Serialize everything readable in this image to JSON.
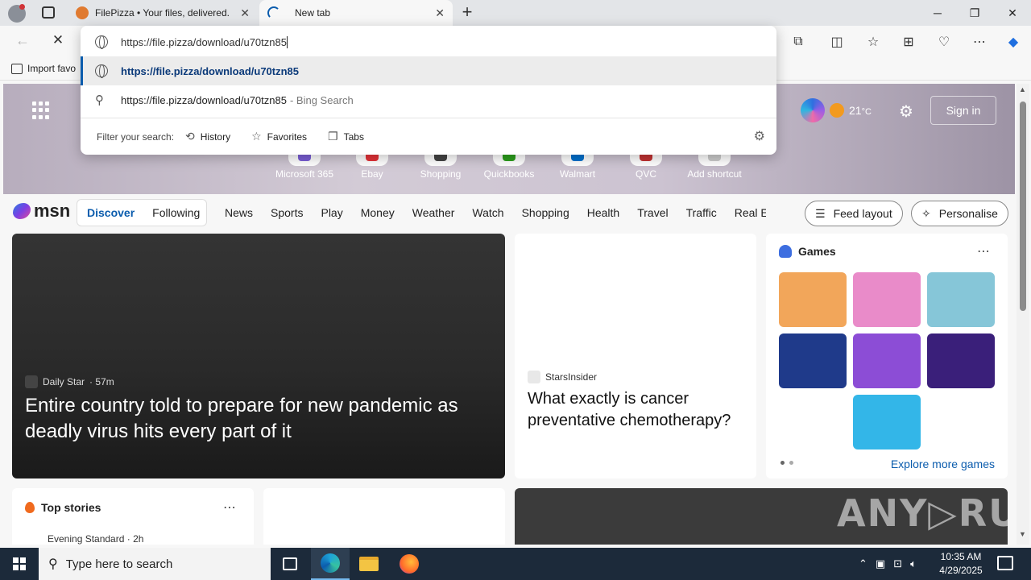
{
  "tabs": [
    {
      "title": "FilePizza • Your files, delivered.",
      "favicon": "pizza-icon"
    },
    {
      "title": "New tab",
      "favicon": "loading-icon"
    }
  ],
  "window_controls": {
    "minimize": "─",
    "restore": "❐",
    "close": "✕"
  },
  "toolbar": {
    "back": "←",
    "stop": "✕",
    "icons": [
      "extensions-icon",
      "split-screen-icon",
      "favorites-icon",
      "collections-icon",
      "performance-icon",
      "more-icon",
      "copilot-icon"
    ]
  },
  "favorites_bar": {
    "import_label": "Import favo"
  },
  "omnibox": {
    "input_value": "https://file.pizza/download/u70tzn85",
    "suggestion_url": "https://file.pizza/download/u70tzn85",
    "bing_query": "https://file.pizza/download/u70tzn85",
    "bing_suffix": "- Bing Search",
    "filter_label": "Filter your search:",
    "filters": [
      "History",
      "Favorites",
      "Tabs"
    ]
  },
  "hero": {
    "shortcuts": [
      {
        "label": "Microsoft 365",
        "color": "#7b5fd6"
      },
      {
        "label": "Ebay",
        "color": "#e53238"
      },
      {
        "label": "Shopping",
        "color": "#444444"
      },
      {
        "label": "Quickbooks",
        "color": "#2ca01c"
      },
      {
        "label": "Walmart",
        "color": "#0071ce"
      },
      {
        "label": "QVC",
        "color": "#c33333"
      },
      {
        "label": "Add shortcut",
        "color": "#cccccc"
      }
    ],
    "temperature": "21",
    "temp_unit": "°C",
    "signin": "Sign in"
  },
  "msn": {
    "logo": "msn",
    "pill": [
      "Discover",
      "Following"
    ],
    "nav": [
      "News",
      "Sports",
      "Play",
      "Money",
      "Weather",
      "Watch",
      "Shopping",
      "Health",
      "Travel",
      "Traffic",
      "Real E"
    ],
    "feed_layout": "Feed layout",
    "personalise": "Personalise"
  },
  "cards": {
    "main": {
      "source": "Daily Star",
      "time": "· 57m",
      "headline": "Entire country told to prepare for new pandemic as deadly virus hits every part of it"
    },
    "mid": {
      "source": "StarsInsider",
      "headline": "What exactly is cancer preventative chemotherapy?"
    },
    "games": {
      "title": "Games",
      "explore": "Explore more games",
      "tiles": [
        "#f2a65a",
        "#e98bc9",
        "#86c6d8",
        "#1f3a8a",
        "#8c4dd6",
        "#3a1f7a",
        "#33b6e8"
      ]
    },
    "top_stories": {
      "title": "Top stories",
      "source": "Evening Standard · 2h"
    },
    "watermark": "ANY▷RUN"
  },
  "taskbar": {
    "search_placeholder": "Type here to search",
    "time": "10:35 AM",
    "date": "4/29/2025"
  }
}
